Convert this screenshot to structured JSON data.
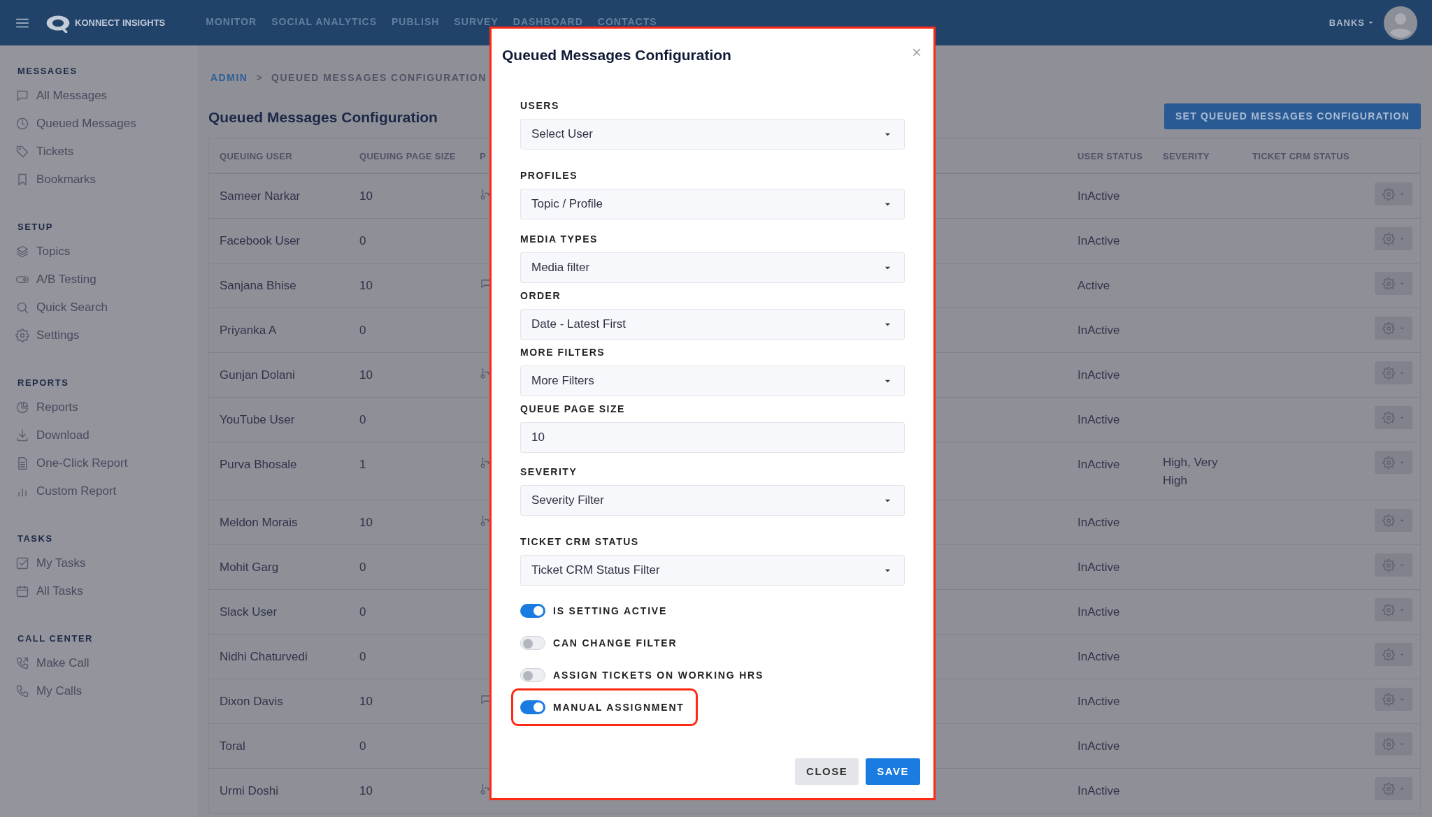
{
  "top_bar": {
    "brand": "KONNECT INSIGHTS",
    "menu": [
      "MONITOR",
      "SOCIAL ANALYTICS",
      "PUBLISH",
      "SURVEY",
      "DASHBOARD",
      "CONTACTS"
    ],
    "account": "BANKS"
  },
  "sidebar": [
    {
      "heading": "MESSAGES",
      "items": [
        "All Messages",
        "Queued Messages",
        "Tickets",
        "Bookmarks"
      ]
    },
    {
      "heading": "SETUP",
      "items": [
        "Topics",
        "A/B Testing",
        "Quick Search",
        "Settings"
      ]
    },
    {
      "heading": "REPORTS",
      "items": [
        "Reports",
        "Download",
        "One-Click Report",
        "Custom Report"
      ]
    },
    {
      "heading": "TASKS",
      "items": [
        "My Tasks",
        "All Tasks"
      ]
    },
    {
      "heading": "CALL CENTER",
      "items": [
        "Make Call",
        "My Calls"
      ]
    }
  ],
  "breadcrumb": [
    {
      "label": "ADMIN",
      "link": true
    },
    {
      "label": "QUEUED MESSAGES CONFIGURATION",
      "link": false
    }
  ],
  "breadcrumb_separator": ">",
  "page_title": "Queued Messages Configuration",
  "set_button": "SET QUEUED MESSAGES CONFIGURATION",
  "table": {
    "columns": [
      "QUEUING USER",
      "QUEUING PAGE SIZE",
      "P",
      "USER STATUS",
      "SEVERITY",
      "TICKET CRM STATUS"
    ],
    "rows": [
      {
        "user": "Sameer Narkar",
        "page_size": "10",
        "kind": "link",
        "status": "InActive"
      },
      {
        "user": "Facebook User",
        "page_size": "0",
        "kind": "plain",
        "status": "InActive"
      },
      {
        "user": "Sanjana Bhise",
        "page_size": "10",
        "kind": "chat",
        "status": "Active"
      },
      {
        "user": "Priyanka A",
        "page_size": "0",
        "kind": "plain",
        "status": "InActive"
      },
      {
        "user": "Gunjan Dolani",
        "page_size": "10",
        "kind": "link",
        "status": "InActive"
      },
      {
        "user": "YouTube User",
        "page_size": "0",
        "kind": "plain",
        "status": "InActive"
      },
      {
        "user": "Purva Bhosale",
        "page_size": "1",
        "kind": "link",
        "status": "InActive",
        "severity": "High, Very High"
      },
      {
        "user": "Meldon Morais",
        "page_size": "10",
        "kind": "link",
        "status": "InActive"
      },
      {
        "user": "Mohit Garg",
        "page_size": "0",
        "kind": "plain",
        "status": "InActive"
      },
      {
        "user": "Slack User",
        "page_size": "0",
        "kind": "plain",
        "status": "InActive"
      },
      {
        "user": "Nidhi Chaturvedi",
        "page_size": "0",
        "kind": "plain",
        "status": "InActive"
      },
      {
        "user": "Dixon Davis",
        "page_size": "10",
        "kind": "chat",
        "status": "InActive"
      },
      {
        "user": "Toral",
        "page_size": "0",
        "kind": "plain",
        "status": "InActive"
      },
      {
        "user": "Urmi Doshi",
        "page_size": "10",
        "kind": "link",
        "status": "InActive"
      }
    ]
  },
  "modal": {
    "title": "Queued Messages Configuration",
    "close_icon": "×",
    "fields": [
      {
        "kind": "select",
        "label": "USERS",
        "value": "Select User"
      },
      {
        "kind": "select",
        "label": "PROFILES",
        "value": "Topic / Profile"
      },
      {
        "kind": "select",
        "label": "MEDIA TYPES",
        "value": "Media filter"
      },
      {
        "kind": "select",
        "label": "ORDER",
        "value": "Date - Latest First"
      },
      {
        "kind": "select",
        "label": "MORE FILTERS",
        "value": "More Filters"
      },
      {
        "kind": "input",
        "label": "QUEUE PAGE SIZE",
        "value": "10"
      },
      {
        "kind": "select",
        "label": "SEVERITY",
        "value": "Severity Filter"
      },
      {
        "kind": "select",
        "label": "TICKET CRM STATUS",
        "value": "Ticket CRM Status Filter"
      }
    ],
    "toggles": [
      {
        "label": "IS SETTING ACTIVE",
        "on": true,
        "highlighted": false
      },
      {
        "label": "CAN CHANGE FILTER",
        "on": false,
        "highlighted": false
      },
      {
        "label": "ASSIGN TICKETS ON WORKING HRS",
        "on": false,
        "highlighted": false
      },
      {
        "label": "MANUAL ASSIGNMENT",
        "on": true,
        "highlighted": true
      }
    ],
    "buttons": [
      "CLOSE",
      "SAVE"
    ]
  }
}
